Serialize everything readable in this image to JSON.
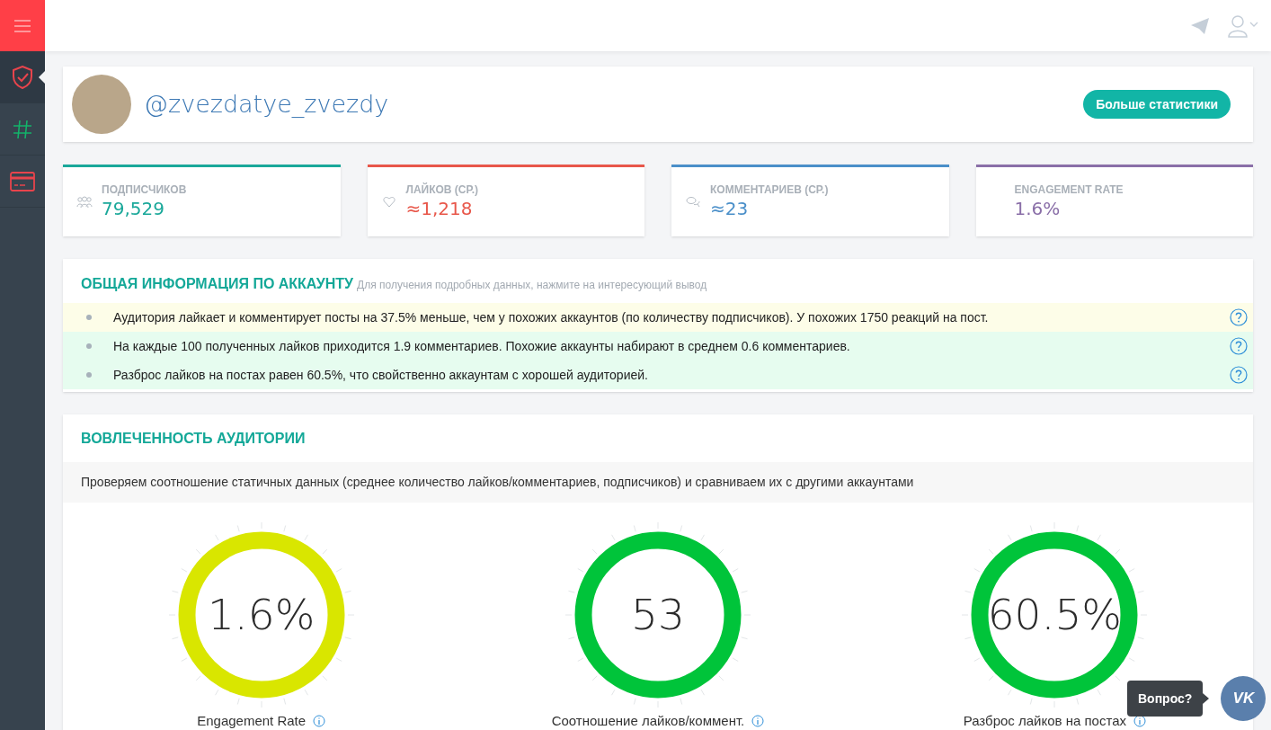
{
  "sidebar": {
    "items": [
      {
        "kind": "shield",
        "selected": true
      },
      {
        "kind": "hash",
        "selected": false
      },
      {
        "kind": "card",
        "selected": false
      }
    ]
  },
  "profile": {
    "username": "@zvezdatye_zvezdy",
    "button": "Больше статистики"
  },
  "stats": [
    {
      "kind": "people",
      "label": "ПОДПИСЧИКОВ",
      "value": "79,529",
      "color": "#1aa89a"
    },
    {
      "kind": "heart",
      "label": "ЛАЙКОВ (СР.)",
      "value": "≈1,218",
      "color": "#e8574a"
    },
    {
      "kind": "comment",
      "label": "КОММЕНТАРИЕВ (СР.)",
      "value": "≈23",
      "color": "#4a8fc9"
    },
    {
      "kind": "none",
      "label": "ENGAGEMENT RATE",
      "value": "1.6%",
      "color": "#8a6fa8"
    }
  ],
  "overview": {
    "title": "ОБЩАЯ ИНФОРМАЦИЯ ПО АККАУНТУ",
    "hint": "Для получения подробных данных, нажмите на интересующий вывод",
    "items": [
      {
        "text": "Аудитория лайкает и комментирует посты на 37.5% меньше, чем у похожих аккаунтов (по количеству подписчиков). У похожих 1750 реакций на пост.",
        "color": "#fdfde8"
      },
      {
        "text": "На каждые 100 полученных лайков приходится 1.9 комментариев. Похожие аккаунты набирают в среднем 0.6 комментариев.",
        "color": "#e6fcef"
      },
      {
        "text": "Разброс лайков на постах равен 60.5%, что свойственно аккаунтам с хорошей аудиторией.",
        "color": "#e6fcef"
      }
    ]
  },
  "engagement": {
    "title": "ВОВЛЕЧЕННОСТЬ АУДИТОРИИ",
    "description": "Проверяем соотношение статичных данных (среднее количество лайков/комментариев, подписчиков) и сравниваем их с другими аккаунтами",
    "gauges": [
      {
        "value": "1.6%",
        "label": "Engagement Rate",
        "color": "#d9e600"
      },
      {
        "value": "53",
        "label": "Соотношение лайков/коммент.",
        "color": "#00c43a"
      },
      {
        "value": "60.5%",
        "label": "Разброс лайков на постах",
        "color": "#00c43a"
      }
    ]
  },
  "chat": {
    "tooltip": "Вопрос?",
    "logo": "VK"
  }
}
